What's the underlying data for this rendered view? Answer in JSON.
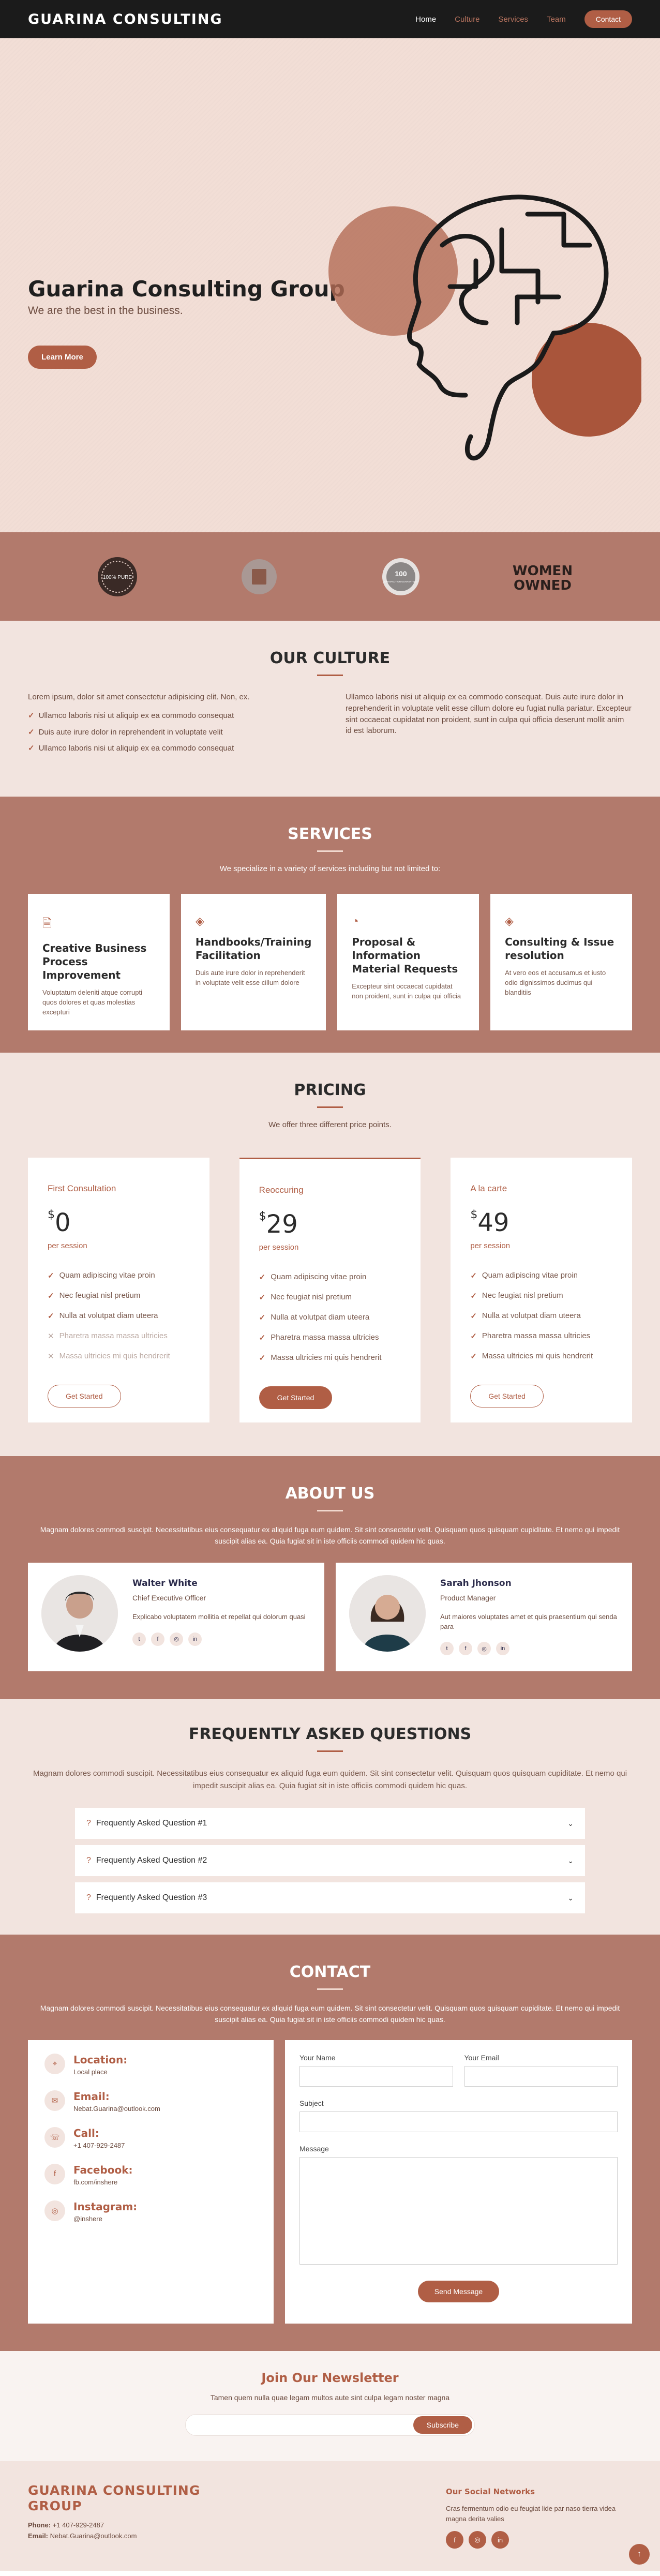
{
  "header": {
    "logo": "GUARINA CONSULTING",
    "nav": [
      "Home",
      "Culture",
      "Services",
      "Team"
    ],
    "contact_label": "Contact"
  },
  "hero": {
    "title": "Guarina Consulting Group",
    "subtitle": "We are the best in the business.",
    "button": "Learn More"
  },
  "clients": {
    "badge_1": "100% PURE",
    "badge_3_num": "100",
    "badge_3_text": "SATISFACTION GUARANTEED",
    "badge_4_line1": "WOMEN",
    "badge_4_line2": "OWNED"
  },
  "culture": {
    "title": "OUR CULTURE",
    "left_intro": "Lorem ipsum, dolor sit amet consectetur adipisicing elit. Non, ex.",
    "left_items": [
      "Ullamco laboris nisi ut aliquip ex ea commodo consequat",
      "Duis aute irure dolor in reprehenderit in voluptate velit",
      "Ullamco laboris nisi ut aliquip ex ea commodo consequat"
    ],
    "right_text": "Ullamco laboris nisi ut aliquip ex ea commodo consequat. Duis aute irure dolor in reprehenderit in voluptate velit esse cillum dolore eu fugiat nulla pariatur. Excepteur sint occaecat cupidatat non proident, sunt in culpa qui officia deserunt mollit anim id est laborum."
  },
  "services": {
    "title": "SERVICES",
    "subtitle": "We specialize in a variety of services including but not limited to:",
    "cards": [
      {
        "icon": "document-icon",
        "title": "Creative Business Process Improvement",
        "text": "Voluptatum deleniti atque corrupti quos dolores et quas molestias excepturi"
      },
      {
        "icon": "layers-icon",
        "title": "Handbooks/Training Facilitation",
        "text": "Duis aute irure dolor in reprehenderit in voluptate velit esse cillum dolore"
      },
      {
        "icon": "speedometer-icon",
        "title": "Proposal & Information Material Requests",
        "text": "Excepteur sint occaecat cupidatat non proident, sunt in culpa qui officia"
      },
      {
        "icon": "layers-icon",
        "title": "Consulting & Issue resolution",
        "text": "At vero eos et accusamus et iusto odio dignissimos ducimus qui blanditiis"
      }
    ]
  },
  "pricing": {
    "title": "PRICING",
    "subtitle": "We offer three different price points.",
    "plans": [
      {
        "name": "First Consultation",
        "currency": "$",
        "price": "0",
        "per": "per session",
        "button": "Get Started",
        "features": [
          "Quam adipiscing vitae proin",
          "Nec feugiat nisl pretium",
          "Nulla at volutpat diam uteera",
          "Pharetra massa massa ultricies",
          "Massa ultricies mi quis hendrerit"
        ]
      },
      {
        "name": "Reoccuring",
        "currency": "$",
        "price": "29",
        "per": "per session",
        "button": "Get Started",
        "features": [
          "Quam adipiscing vitae proin",
          "Nec feugiat nisl pretium",
          "Nulla at volutpat diam uteera",
          "Pharetra massa massa ultricies",
          "Massa ultricies mi quis hendrerit"
        ]
      },
      {
        "name": "A la carte",
        "currency": "$",
        "price": "49",
        "per": "per session",
        "button": "Get Started",
        "features": [
          "Quam adipiscing vitae proin",
          "Nec feugiat nisl pretium",
          "Nulla at volutpat diam uteera",
          "Pharetra massa massa ultricies",
          "Massa ultricies mi quis hendrerit"
        ]
      }
    ]
  },
  "about": {
    "title": "ABOUT US",
    "subtitle": "Magnam dolores commodi suscipit. Necessitatibus eius consequatur ex aliquid fuga eum quidem. Sit sint consectetur velit. Quisquam quos quisquam cupiditate. Et nemo qui impedit suscipit alias ea. Quia fugiat sit in iste officiis commodi quidem hic quas.",
    "members": [
      {
        "name": "Walter White",
        "role": "Chief Executive Officer",
        "text": "Explicabo voluptatem mollitia et repellat qui dolorum quasi"
      },
      {
        "name": "Sarah Jhonson",
        "role": "Product Manager",
        "text": "Aut maiores voluptates amet et quis praesentium qui senda para"
      }
    ]
  },
  "faq": {
    "title": "FREQUENTLY ASKED QUESTIONS",
    "subtitle": "Magnam dolores commodi suscipit. Necessitatibus eius consequatur ex aliquid fuga eum quidem. Sit sint consectetur velit. Quisquam quos quisquam cupiditate. Et nemo qui impedit suscipit alias ea. Quia fugiat sit in iste officiis commodi quidem hic quas.",
    "items": [
      "Frequently Asked Question #1",
      "Frequently Asked Question #2",
      "Frequently Asked Question #3"
    ]
  },
  "contact": {
    "title": "CONTACT",
    "subtitle": "Magnam dolores commodi suscipit. Necessitatibus eius consequatur ex aliquid fuga eum quidem. Sit sint consectetur velit. Quisquam quos quisquam cupiditate. Et nemo qui impedit suscipit alias ea. Quia fugiat sit in iste officiis commodi quidem hic quas.",
    "info": [
      {
        "label": "Location:",
        "value": "Local place"
      },
      {
        "label": "Email:",
        "value": "Nebat.Guarina@outlook.com"
      },
      {
        "label": "Call:",
        "value": "+1 407-929-2487"
      },
      {
        "label": "Facebook:",
        "value": "fb.com/inshere"
      },
      {
        "label": "Instagram:",
        "value": "@inshere"
      }
    ],
    "form": {
      "name_label": "Your Name",
      "email_label": "Your Email",
      "subject_label": "Subject",
      "message_label": "Message",
      "button": "Send Message"
    }
  },
  "newsletter": {
    "title": "Join Our Newsletter",
    "text": "Tamen quem nulla quae legam multos aute sint culpa legam noster magna",
    "button": "Subscribe"
  },
  "footer": {
    "brand": "GUARINA CONSULTING GROUP",
    "phone_label": "Phone:",
    "phone": "+1 407-929-2487",
    "email_label": "Email:",
    "email": "Nebat.Guarina@outlook.com",
    "social_title": "Our Social Networks",
    "social_text": "Cras fermentum odio eu feugiat lide par naso tierra videa magna derita valies"
  },
  "colors": {
    "accent": "#b05e45",
    "section_dark": "#b27a6c",
    "section_light": "#f2e4df",
    "hero": "#f2ded6"
  }
}
